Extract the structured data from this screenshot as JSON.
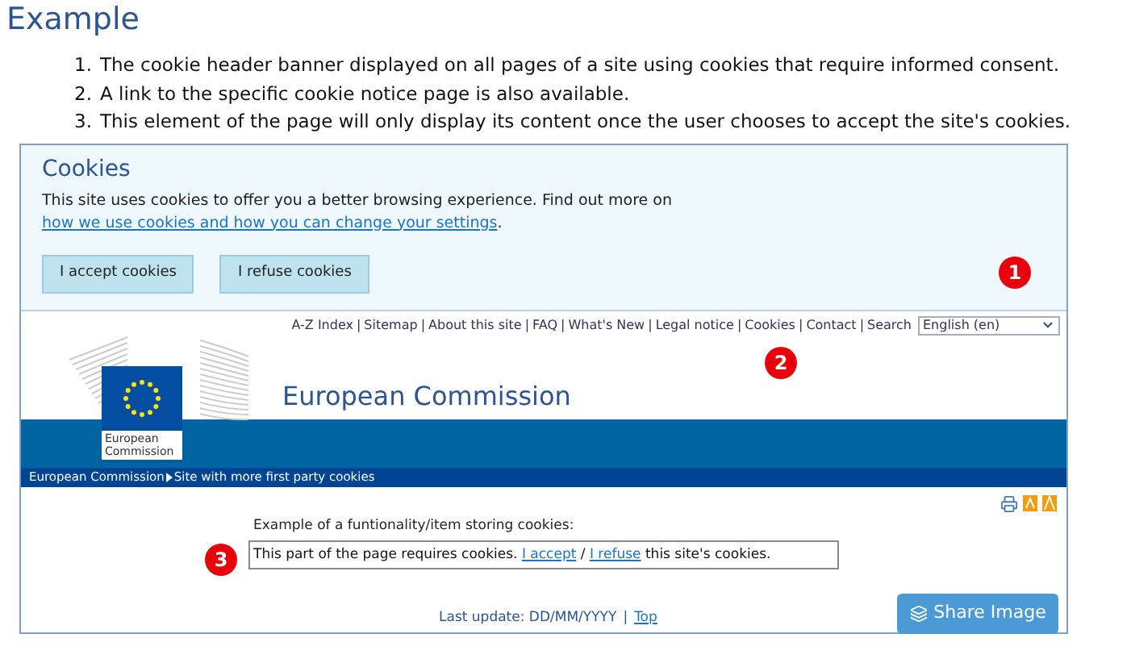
{
  "heading": "Example",
  "notes": [
    {
      "number": "1.",
      "text": "The cookie header banner displayed on all pages of a site using cookies that require informed consent."
    },
    {
      "number": "2.",
      "text": "A link to the specific cookie notice page is also available."
    },
    {
      "number": "3.",
      "text": "This element of the page will only display its content once the user chooses to accept the site's cookies."
    }
  ],
  "banner": {
    "title": "Cookies",
    "text": "This site uses cookies to offer you a better browsing experience. Find out more on ",
    "link": "how we use cookies and how you can change your settings",
    "end": ".",
    "buttons": [
      "I accept cookies",
      "I refuse cookies"
    ],
    "marker": "1"
  },
  "top_links": {
    "items": [
      "A-Z Index",
      "Sitemap",
      "About this site",
      "FAQ",
      "What's New",
      "Legal notice",
      "Cookies",
      "Contact",
      "Search"
    ],
    "separator": "|",
    "language": "English (en)",
    "marker": "2"
  },
  "logo_caption": "European Commission",
  "site_title": "European Commission",
  "breadcrumb": [
    "European Commission",
    "Site with more first party cookies"
  ],
  "content": {
    "label": "Example of a funtionality/item storing cookies:",
    "text": "This part of the page requires cookies. ",
    "accept": "I accept",
    "slash": " / ",
    "refuse": "I refuse",
    "end": " this site's cookies.",
    "marker": "3"
  },
  "footer": {
    "text": "Last update: DD/MM/YYYY",
    "separator": "|",
    "link": "Top"
  },
  "share_button": "Share Image"
}
